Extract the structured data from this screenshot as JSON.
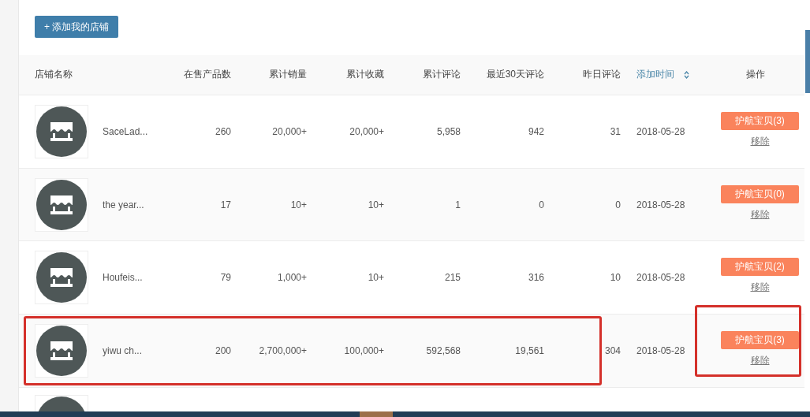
{
  "add_button": "+ 添加我的店铺",
  "columns": [
    {
      "label": "店铺名称",
      "kind": "text"
    },
    {
      "label": "在售产品数",
      "kind": "num"
    },
    {
      "label": "累计销量",
      "kind": "num"
    },
    {
      "label": "累计收藏",
      "kind": "num"
    },
    {
      "label": "累计评论",
      "kind": "num"
    },
    {
      "label": "最近30天评论",
      "kind": "num"
    },
    {
      "label": "昨日评论",
      "kind": "num"
    },
    {
      "label": "添加时间",
      "kind": "sortable"
    },
    {
      "label": "操作",
      "kind": "center"
    }
  ],
  "rows": [
    {
      "name": "SaceLad...",
      "products": "260",
      "sales": "20,000+",
      "favorites": "20,000+",
      "reviews": "5,958",
      "reviews_30d": "942",
      "reviews_yesterday": "31",
      "added": "2018-05-28",
      "guard_button": "护航宝贝(3)",
      "remove_link": "移除",
      "highlighted": false
    },
    {
      "name": "the year...",
      "products": "17",
      "sales": "10+",
      "favorites": "10+",
      "reviews": "1",
      "reviews_30d": "0",
      "reviews_yesterday": "0",
      "added": "2018-05-28",
      "guard_button": "护航宝贝(0)",
      "remove_link": "移除",
      "highlighted": false
    },
    {
      "name": "Houfeis...",
      "products": "79",
      "sales": "1,000+",
      "favorites": "10+",
      "reviews": "215",
      "reviews_30d": "316",
      "reviews_yesterday": "10",
      "added": "2018-05-28",
      "guard_button": "护航宝贝(2)",
      "remove_link": "移除",
      "highlighted": false
    },
    {
      "name": "yiwu ch...",
      "products": "200",
      "sales": "2,700,000+",
      "favorites": "100,000+",
      "reviews": "592,568",
      "reviews_30d": "19,561",
      "reviews_yesterday": "304",
      "added": "2018-05-28",
      "guard_button": "护航宝贝(3)",
      "remove_link": "移除",
      "highlighted": true
    }
  ]
}
